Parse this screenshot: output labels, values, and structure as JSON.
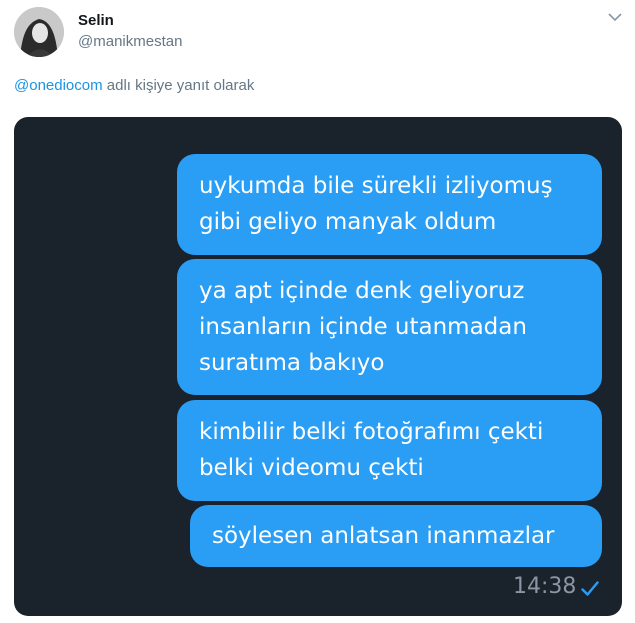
{
  "tweet": {
    "author_name": "Selin",
    "author_handle": "@manikmestan",
    "reply_mention": "@onediocom",
    "reply_text": " adlı kişiye yanıt olarak"
  },
  "chat": {
    "messages": [
      {
        "lines": [
          "uykumda bile sürekli izliyomuş",
          "gibi geliyo manyak oldum"
        ]
      },
      {
        "lines": [
          "ya apt içinde denk geliyoruz",
          "insanların içinde utanmadan",
          "suratıma bakıyo"
        ]
      },
      {
        "lines": [
          "kimbilir belki fotoğrafımı çekti",
          "belki videomu çekti"
        ]
      },
      {
        "lines": [
          "söylesen anlatsan inanmazlar"
        ]
      }
    ],
    "time": "14:38",
    "status_icon": "check-icon"
  },
  "colors": {
    "bubble": "#2a9df4",
    "chat_background": "#1a222c",
    "mention": "#1b95e0"
  }
}
